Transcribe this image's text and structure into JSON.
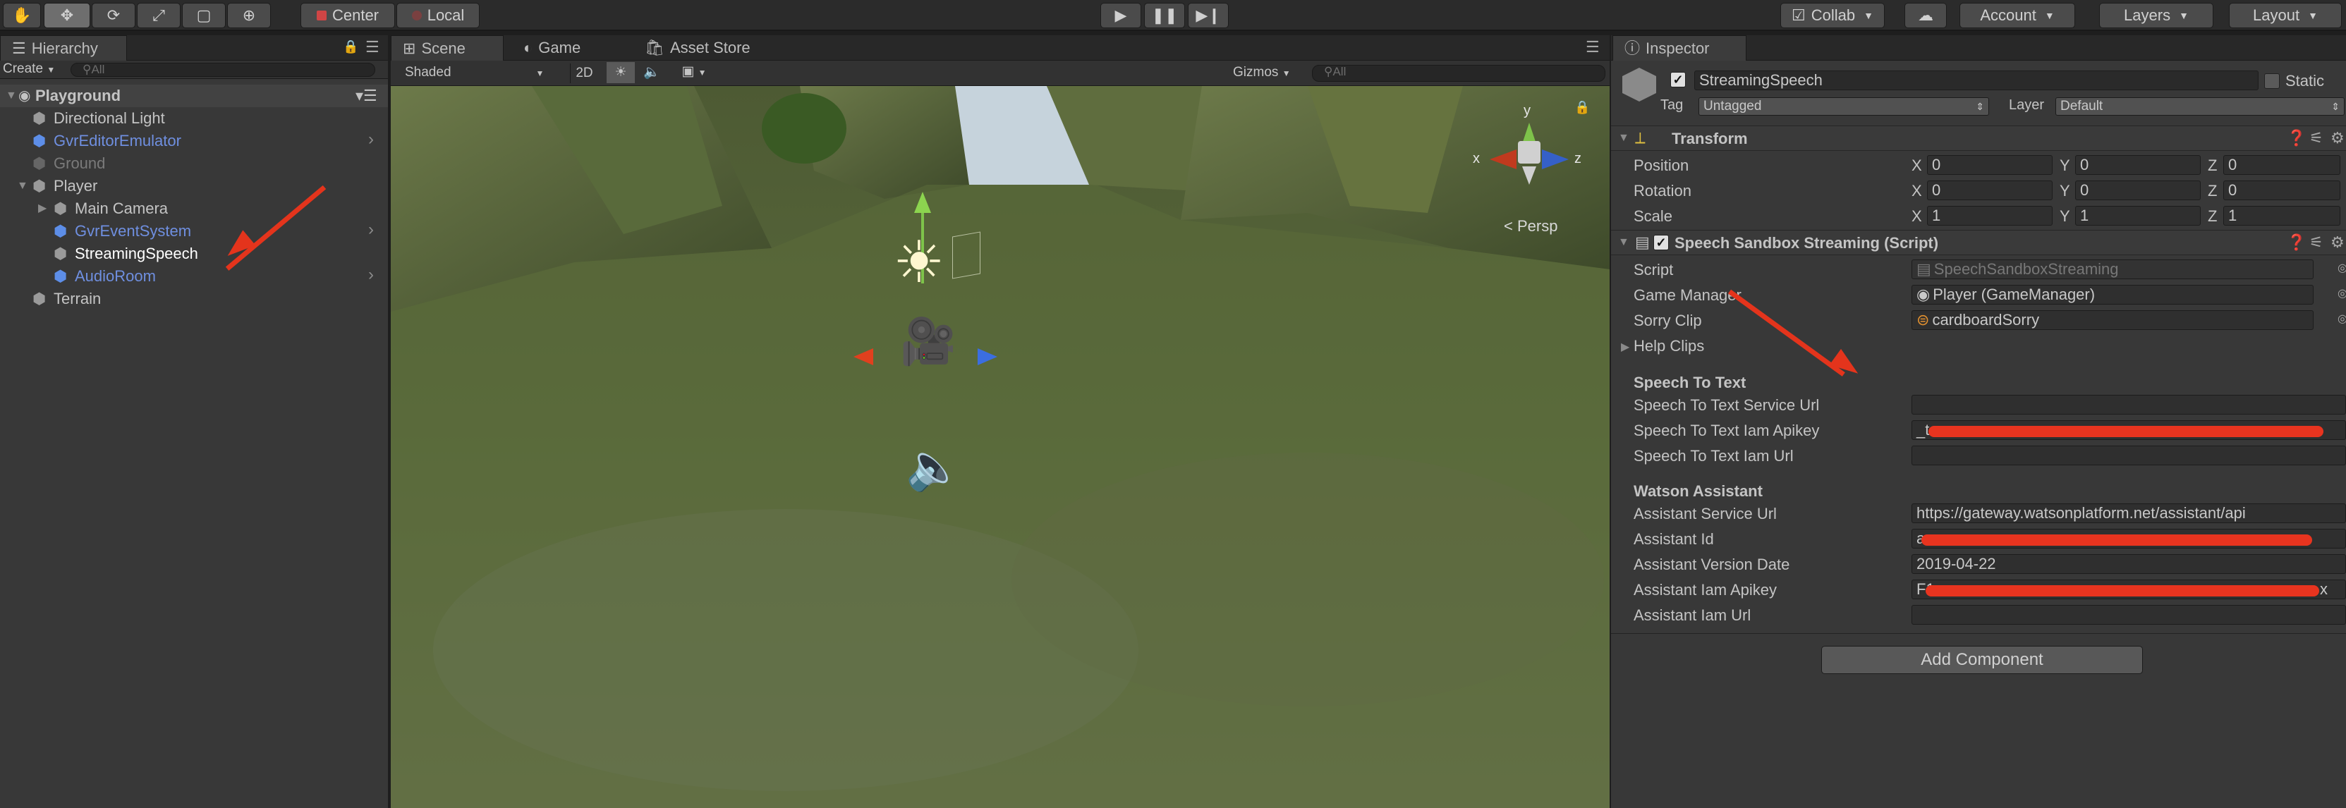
{
  "toolbar": {
    "tools": [
      "hand-tool",
      "move-tool",
      "rotate-tool",
      "scale-tool",
      "rect-tool",
      "transform-tool"
    ],
    "pivot": "Center",
    "space": "Local",
    "play_controls": [
      "play",
      "pause",
      "step"
    ],
    "collab": "Collab",
    "account": "Account",
    "layers": "Layers",
    "layout": "Layout"
  },
  "hierarchy": {
    "tab": "Hierarchy",
    "create": "Create",
    "search_placeholder": "All",
    "scene_name": "Playground",
    "items": [
      {
        "label": "Directional Light",
        "style": "normal"
      },
      {
        "label": "GvrEditorEmulator",
        "style": "prefab"
      },
      {
        "label": "Ground",
        "style": "disabled"
      },
      {
        "label": "Player",
        "style": "normal"
      },
      {
        "label": "Main Camera",
        "style": "normal"
      },
      {
        "label": "GvrEventSystem",
        "style": "prefab"
      },
      {
        "label": "StreamingSpeech",
        "style": "selected"
      },
      {
        "label": "AudioRoom",
        "style": "prefab"
      },
      {
        "label": "Terrain",
        "style": "normal"
      }
    ]
  },
  "scene": {
    "tabs": [
      "Scene",
      "Game",
      "Asset Store"
    ],
    "shading": "Shaded",
    "mode_2d": "2D",
    "gizmos": "Gizmos",
    "search_placeholder": "All",
    "gizmo_labels": {
      "x": "x",
      "y": "y",
      "z": "z"
    },
    "persp": "Persp"
  },
  "inspector": {
    "tab": "Inspector",
    "object_name": "StreamingSpeech",
    "static_label": "Static",
    "tag_label": "Tag",
    "tag_value": "Untagged",
    "layer_label": "Layer",
    "layer_value": "Default",
    "transform": {
      "title": "Transform",
      "rows": [
        {
          "label": "Position",
          "x": "0",
          "y": "0",
          "z": "0"
        },
        {
          "label": "Rotation",
          "x": "0",
          "y": "0",
          "z": "0"
        },
        {
          "label": "Scale",
          "x": "1",
          "y": "1",
          "z": "1"
        }
      ],
      "axis": {
        "x": "X",
        "y": "Y",
        "z": "Z"
      }
    },
    "script_component": {
      "title": "Speech Sandbox Streaming (Script)",
      "script_label": "Script",
      "script_value": "SpeechSandboxStreaming",
      "game_manager_label": "Game Manager",
      "game_manager_value": "Player (GameManager)",
      "sorry_clip_label": "Sorry Clip",
      "sorry_clip_value": "cardboardSorry",
      "help_clips_label": "Help Clips",
      "stt_header": "Speech To Text",
      "stt_service_url_label": "Speech To Text Service Url",
      "stt_service_url_value": "",
      "stt_iam_apikey_label": "Speech To Text Iam Apikey",
      "stt_iam_apikey_value": "_t",
      "stt_iam_url_label": "Speech To Text Iam Url",
      "stt_iam_url_value": "",
      "wa_header": "Watson Assistant",
      "assistant_service_url_label": "Assistant Service Url",
      "assistant_service_url_value": "https://gateway.watsonplatform.net/assistant/api",
      "assistant_id_label": "Assistant Id",
      "assistant_id_value": "a",
      "assistant_version_date_label": "Assistant Version Date",
      "assistant_version_date_value": "2019-04-22",
      "assistant_iam_apikey_label": "Assistant Iam Apikey",
      "assistant_iam_apikey_value": "F1",
      "assistant_iam_apikey_tail": "x",
      "assistant_iam_url_label": "Assistant Iam Url",
      "assistant_iam_url_value": ""
    },
    "add_component": "Add Component"
  },
  "colors": {
    "annotation_arrow": "#e4341c",
    "redaction": "#e8341f",
    "prefab_text": "#6f8fe0"
  }
}
